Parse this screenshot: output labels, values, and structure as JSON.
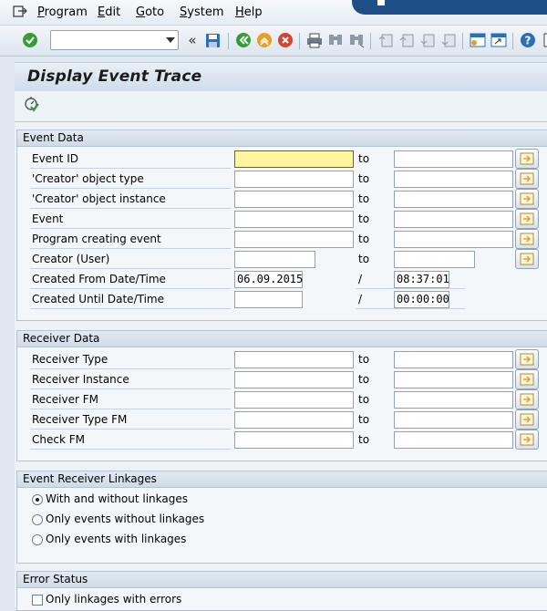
{
  "menu": {
    "items": [
      {
        "first": "P",
        "rest": "rogram"
      },
      {
        "first": "E",
        "rest": "dit"
      },
      {
        "first": "G",
        "rest": "oto"
      },
      {
        "first": "S",
        "rest": "ystem"
      },
      {
        "first": "H",
        "rest": "elp"
      }
    ]
  },
  "toolbar": {
    "command_field_value": "",
    "icons": [
      "enter-icon",
      "save-icon",
      "back-icon",
      "exit-icon",
      "cancel-icon",
      "print-icon",
      "find-icon",
      "find-next-icon",
      "first-page-icon",
      "previous-page-icon",
      "next-page-icon",
      "last-page-icon",
      "create-session-icon",
      "shortcut-icon",
      "help-icon"
    ]
  },
  "page": {
    "title": "Display Event Trace"
  },
  "event_data": {
    "title": "Event Data",
    "rows": [
      {
        "label": "Event ID",
        "from": "",
        "to_label": "to",
        "to": ""
      },
      {
        "label": "'Creator' object type",
        "from": "",
        "to_label": "to",
        "to": ""
      },
      {
        "label": "'Creator' object instance",
        "from": "",
        "to_label": "to",
        "to": ""
      },
      {
        "label": "Event",
        "from": "",
        "to_label": "to",
        "to": ""
      },
      {
        "label": "Program creating event",
        "from": "",
        "to_label": "to",
        "to": ""
      },
      {
        "label": "Creator (User)",
        "from": "",
        "to_label": "to",
        "to": ""
      },
      {
        "label": "Created From Date/Time",
        "from": "06.09.2015",
        "to_label": "/",
        "to": "08:37:01"
      },
      {
        "label": "Created Until Date/Time",
        "from": "",
        "to_label": "/",
        "to": "00:00:00"
      }
    ]
  },
  "receiver_data": {
    "title": "Receiver Data",
    "rows": [
      {
        "label": "Receiver Type",
        "from": "",
        "to_label": "to",
        "to": ""
      },
      {
        "label": "Receiver Instance",
        "from": "",
        "to_label": "to",
        "to": ""
      },
      {
        "label": "Receiver FM",
        "from": "",
        "to_label": "to",
        "to": ""
      },
      {
        "label": "Receiver Type FM",
        "from": "",
        "to_label": "to",
        "to": ""
      },
      {
        "label": "Check FM",
        "from": "",
        "to_label": "to",
        "to": ""
      }
    ]
  },
  "linkages": {
    "title": "Event Receiver Linkages",
    "options": [
      {
        "label": "With and without linkages",
        "selected": true
      },
      {
        "label": "Only events without linkages",
        "selected": false
      },
      {
        "label": "Only events with linkages",
        "selected": false
      }
    ]
  },
  "error_status": {
    "title": "Error Status",
    "checkbox_label": "Only linkages with errors",
    "checked": false
  },
  "colors": {
    "accent": "#1f4f87",
    "focus_field": "#fff59e",
    "multi_select_arrow": "#e6a23c"
  }
}
